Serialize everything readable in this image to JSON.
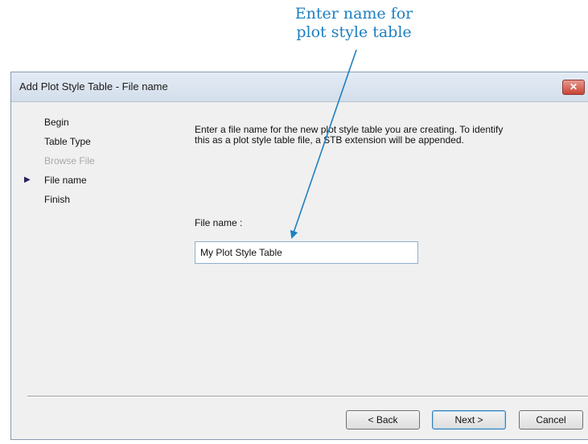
{
  "callout": {
    "line1": "Enter name for",
    "line2": "plot style table"
  },
  "dialog": {
    "title": "Add Plot Style Table - File name",
    "close_label": "✕",
    "steps": [
      {
        "label": "Begin",
        "state": "done"
      },
      {
        "label": "Table Type",
        "state": "done"
      },
      {
        "label": "Browse File",
        "state": "disabled"
      },
      {
        "label": "File name",
        "state": "current"
      },
      {
        "label": "Finish",
        "state": "pending"
      }
    ],
    "current_marker": "▶",
    "description": "Enter a file name for the new plot style table you are creating. To identify this as a plot style table file, a STB extension will be appended.",
    "file_name_label": "File name :",
    "file_name_value": "My Plot Style Table",
    "buttons": {
      "back": "< Back",
      "next": "Next >",
      "cancel": "Cancel"
    }
  },
  "colors": {
    "callout": "#1e7fc0",
    "marker": "#27235e"
  }
}
